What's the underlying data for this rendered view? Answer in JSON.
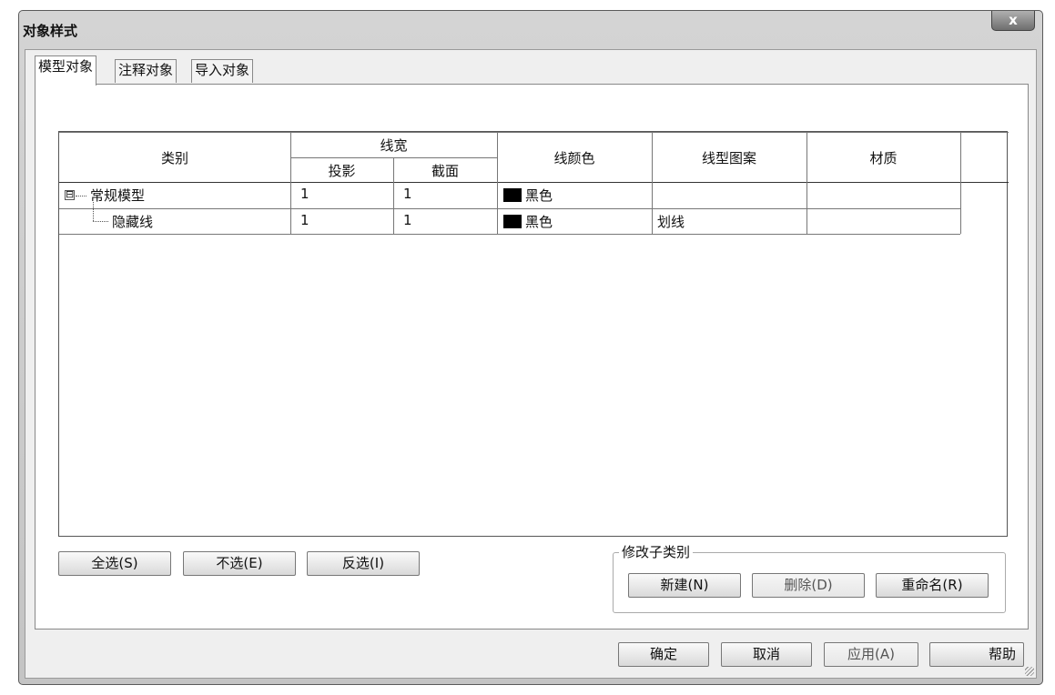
{
  "window": {
    "title": "对象样式",
    "close_label": "x"
  },
  "tabs": [
    "模型对象",
    "注释对象",
    "导入对象"
  ],
  "table": {
    "headers": {
      "category": "类别",
      "line_weight": "线宽",
      "projection": "投影",
      "cut": "截面",
      "line_color": "线颜色",
      "line_pattern": "线型图案",
      "material": "材质"
    },
    "rows": [
      {
        "expander": "⊟",
        "category": "常规模型",
        "projection": "1",
        "cut": "1",
        "color_swatch": "#000000",
        "color": "黑色",
        "pattern": "",
        "material": ""
      },
      {
        "expander": "",
        "category": "隐藏线",
        "projection": "1",
        "cut": "1",
        "color_swatch": "#000000",
        "color": "黑色",
        "pattern": "划线",
        "material": ""
      }
    ]
  },
  "select_buttons": {
    "select_all": "全选(S)",
    "select_none": "不选(E)",
    "invert": "反选(I)"
  },
  "modify_subcategory": {
    "title": "修改子类别",
    "new": "新建(N)",
    "delete": "删除(D)",
    "rename": "重命名(R)"
  },
  "footer": {
    "ok": "确定",
    "cancel": "取消",
    "apply": "应用(A)",
    "help": "帮助"
  }
}
